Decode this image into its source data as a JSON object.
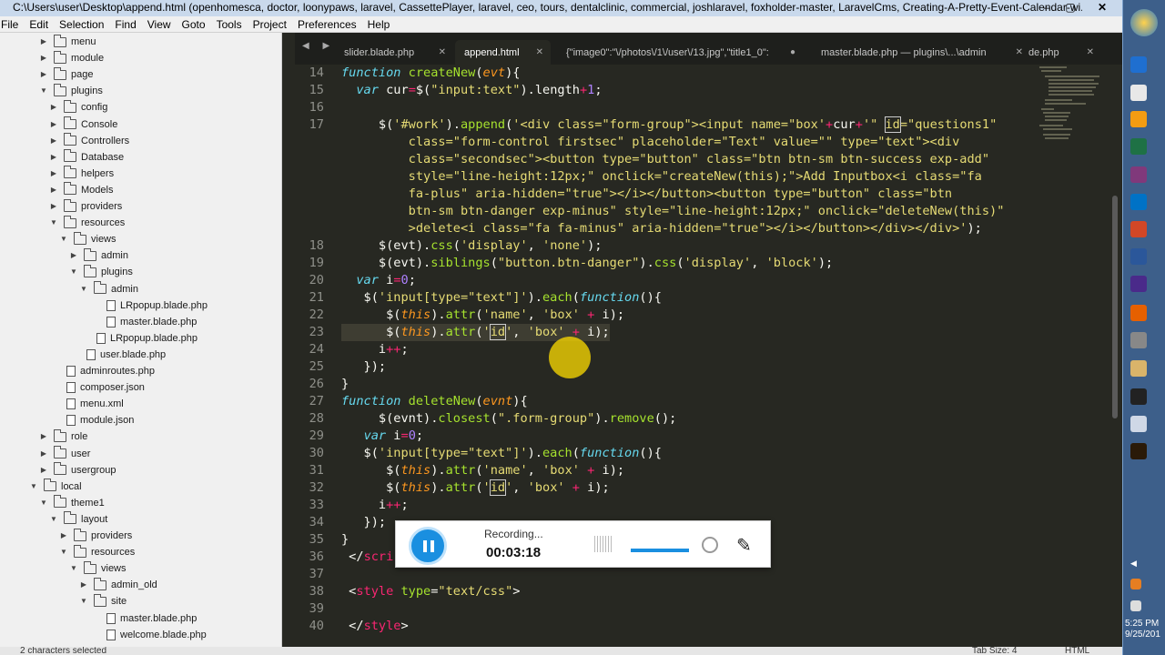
{
  "window": {
    "title": "C:\\Users\\user\\Desktop\\append.html (openhomesca, doctor, loonypaws, laravel, CassettePlayer, laravel, ceo, tours, dentalclinic, commercial, joshlaravel, foxholder-master, LaravelCms, Creating-A-Pretty-Event-Calendar-wi...",
    "controls": [
      "–",
      "▢",
      "✕"
    ]
  },
  "menu": [
    "File",
    "Edit",
    "Selection",
    "Find",
    "View",
    "Goto",
    "Tools",
    "Project",
    "Preferences",
    "Help"
  ],
  "tree": [
    {
      "label": "menu",
      "type": "folder",
      "depth": 1,
      "open": false
    },
    {
      "label": "module",
      "type": "folder",
      "depth": 1,
      "open": false
    },
    {
      "label": "page",
      "type": "folder",
      "depth": 1,
      "open": false
    },
    {
      "label": "plugins",
      "type": "folder",
      "depth": 1,
      "open": true
    },
    {
      "label": "config",
      "type": "folder",
      "depth": 2,
      "open": false
    },
    {
      "label": "Console",
      "type": "folder",
      "depth": 2,
      "open": false
    },
    {
      "label": "Controllers",
      "type": "folder",
      "depth": 2,
      "open": false
    },
    {
      "label": "Database",
      "type": "folder",
      "depth": 2,
      "open": false
    },
    {
      "label": "helpers",
      "type": "folder",
      "depth": 2,
      "open": false
    },
    {
      "label": "Models",
      "type": "folder",
      "depth": 2,
      "open": false
    },
    {
      "label": "providers",
      "type": "folder",
      "depth": 2,
      "open": false
    },
    {
      "label": "resources",
      "type": "folder",
      "depth": 2,
      "open": true
    },
    {
      "label": "views",
      "type": "folder",
      "depth": 3,
      "open": true
    },
    {
      "label": "admin",
      "type": "folder",
      "depth": 4,
      "open": false
    },
    {
      "label": "plugins",
      "type": "folder",
      "depth": 4,
      "open": true
    },
    {
      "label": "admin",
      "type": "folder",
      "depth": 5,
      "open": true
    },
    {
      "label": "LRpopup.blade.php",
      "type": "file",
      "depth": 6
    },
    {
      "label": "master.blade.php",
      "type": "file",
      "depth": 6
    },
    {
      "label": "LRpopup.blade.php",
      "type": "file",
      "depth": 5
    },
    {
      "label": "user.blade.php",
      "type": "file",
      "depth": 4
    },
    {
      "label": "adminroutes.php",
      "type": "file",
      "depth": 2
    },
    {
      "label": "composer.json",
      "type": "file",
      "depth": 2
    },
    {
      "label": "menu.xml",
      "type": "file",
      "depth": 2
    },
    {
      "label": "module.json",
      "type": "file",
      "depth": 2
    },
    {
      "label": "role",
      "type": "folder",
      "depth": 1,
      "open": false
    },
    {
      "label": "user",
      "type": "folder",
      "depth": 1,
      "open": false
    },
    {
      "label": "usergroup",
      "type": "folder",
      "depth": 1,
      "open": false
    },
    {
      "label": "local",
      "type": "folder",
      "depth": 0,
      "open": true
    },
    {
      "label": "theme1",
      "type": "folder",
      "depth": 1,
      "open": true
    },
    {
      "label": "layout",
      "type": "folder",
      "depth": 2,
      "open": true
    },
    {
      "label": "providers",
      "type": "folder",
      "depth": 3,
      "open": false
    },
    {
      "label": "resources",
      "type": "folder",
      "depth": 3,
      "open": true
    },
    {
      "label": "views",
      "type": "folder",
      "depth": 4,
      "open": true
    },
    {
      "label": "admin_old",
      "type": "folder",
      "depth": 5,
      "open": false
    },
    {
      "label": "site",
      "type": "folder",
      "depth": 5,
      "open": true
    },
    {
      "label": "master.blade.php",
      "type": "file",
      "depth": 6
    },
    {
      "label": "welcome.blade.php",
      "type": "file",
      "depth": 6
    }
  ],
  "tabs": [
    {
      "label": "slider.blade.php",
      "close": "✕",
      "active": false
    },
    {
      "label": "append.html",
      "close": "✕",
      "active": true
    },
    {
      "label": "{\"image0\":\"\\/photos\\/1\\/user\\/13.jpg\",\"title1_0\":",
      "close": "●",
      "active": false
    },
    {
      "label": "master.blade.php — plugins\\...\\admin",
      "close": "✕",
      "active": false
    },
    {
      "label": "de.php",
      "close": "✕",
      "active": false
    }
  ],
  "tab_nav": "◀ ▶",
  "tab_menu": "▼",
  "code_lines": [
    {
      "n": "14",
      "html": "<span class=\"kw\">function</span> <span class=\"fn\">createNew</span>(<span class=\"var\">evt</span>){"
    },
    {
      "n": "15",
      "html": "  <span class=\"kw\">var</span> cur<span class=\"op\">=</span>$(<span class=\"str\">\"input:text\"</span>).length<span class=\"op\">+</span><span class=\"num\">1</span>;"
    },
    {
      "n": "16",
      "html": ""
    },
    {
      "n": "17",
      "html": "     $(<span class=\"str\">'#work'</span>).<span class=\"fn\">append</span>(<span class=\"str\">'&lt;div class=\"form-group\"&gt;&lt;input name=\"box'</span><span class=\"op\">+</span>cur<span class=\"op\">+</span><span class=\"str\">'\" <span class=\"box\">id</span>=\"questions1\"</span>"
    },
    {
      "n": "",
      "html": "         <span class=\"str\">class=\"form-control firstsec\" placeholder=\"Text\" value=\"\" type=\"text\"&gt;&lt;div</span>"
    },
    {
      "n": "",
      "html": "         <span class=\"str\">class=\"secondsec\"&gt;&lt;button type=\"button\" class=\"btn btn-sm btn-success exp-add\"</span>"
    },
    {
      "n": "",
      "html": "         <span class=\"str\">style=\"line-height:12px;\" onclick=\"createNew(this);\"&gt;Add Inputbox&lt;i class=\"fa</span>"
    },
    {
      "n": "",
      "html": "         <span class=\"str\">fa-plus\" aria-hidden=\"true\"&gt;&lt;/i&gt;&lt;/button&gt;&lt;button type=\"button\" class=\"btn</span>"
    },
    {
      "n": "",
      "html": "         <span class=\"str\">btn-sm btn-danger exp-minus\" style=\"line-height:12px;\" onclick=\"deleteNew(this)\"</span>"
    },
    {
      "n": "",
      "html": "         <span class=\"str\">&gt;delete&lt;i class=\"fa fa-minus\" aria-hidden=\"true\"&gt;&lt;/i&gt;&lt;/button&gt;&lt;/div&gt;&lt;/div&gt;'</span>);"
    },
    {
      "n": "18",
      "html": "     $(evt).<span class=\"fn\">css</span>(<span class=\"str\">'display'</span>, <span class=\"str\">'none'</span>);"
    },
    {
      "n": "19",
      "html": "     $(evt).<span class=\"fn\">siblings</span>(<span class=\"str\">\"button.btn-danger\"</span>).<span class=\"fn\">css</span>(<span class=\"str\">'display'</span>, <span class=\"str\">'block'</span>);"
    },
    {
      "n": "20",
      "html": "  <span class=\"kw\">var</span> i<span class=\"op\">=</span><span class=\"num\">0</span>;"
    },
    {
      "n": "21",
      "html": "   $(<span class=\"str\">'input[type=\"text\"]'</span>).<span class=\"fn\">each</span>(<span class=\"kw\">function</span>(){"
    },
    {
      "n": "22",
      "html": "      $(<span class=\"var\">this</span>).<span class=\"fn\">attr</span>(<span class=\"str\">'name'</span>, <span class=\"str\">'box'</span> <span class=\"op\">+</span> i);"
    },
    {
      "n": "23",
      "html": "      $(<span class=\"var\">this</span>).<span class=\"fn\">attr</span>(<span class=\"str\">'<span class=\"box\">id</span>'</span>, <span class=\"str\">'box'</span> <span class=\"op\">+</span> i);",
      "hl": true
    },
    {
      "n": "24",
      "html": "     i<span class=\"op\">++</span>;"
    },
    {
      "n": "25",
      "html": "   });"
    },
    {
      "n": "26",
      "html": "}"
    },
    {
      "n": "27",
      "html": "<span class=\"kw\">function</span> <span class=\"fn\">deleteNew</span>(<span class=\"var\">evnt</span>){"
    },
    {
      "n": "28",
      "html": "     $(evnt).<span class=\"fn\">closest</span>(<span class=\"str\">\".form-group\"</span>).<span class=\"fn\">remove</span>();"
    },
    {
      "n": "29",
      "html": "   <span class=\"kw\">var</span> i<span class=\"op\">=</span><span class=\"num\">0</span>;"
    },
    {
      "n": "30",
      "html": "   $(<span class=\"str\">'input[type=\"text\"]'</span>).<span class=\"fn\">each</span>(<span class=\"kw\">function</span>(){"
    },
    {
      "n": "31",
      "html": "      $(<span class=\"var\">this</span>).<span class=\"fn\">attr</span>(<span class=\"str\">'name'</span>, <span class=\"str\">'box'</span> <span class=\"op\">+</span> i);"
    },
    {
      "n": "32",
      "html": "      $(<span class=\"var\">this</span>).<span class=\"fn\">attr</span>(<span class=\"str\">'<span class=\"box\">id</span>'</span>, <span class=\"str\">'box'</span> <span class=\"op\">+</span> i);"
    },
    {
      "n": "33",
      "html": "     i<span class=\"op\">++</span>;"
    },
    {
      "n": "34",
      "html": "   });"
    },
    {
      "n": "35",
      "html": "}"
    },
    {
      "n": "36",
      "html": " &lt;/<span class=\"tag\">scri</span>"
    },
    {
      "n": "37",
      "html": ""
    },
    {
      "n": "38",
      "html": " &lt;<span class=\"tag\">style</span> <span class=\"fn\">type</span>=<span class=\"str\">\"text/css\"</span>&gt;"
    },
    {
      "n": "39",
      "html": ""
    },
    {
      "n": "40",
      "html": " &lt;/<span class=\"tag\">style</span>&gt;"
    }
  ],
  "recorder": {
    "status": "Recording...",
    "time": "00:03:18"
  },
  "status": {
    "left": "2 characters selected",
    "tab_size": "Tab Size: 4",
    "syntax": "HTML"
  },
  "clock": {
    "time": "5:25 PM",
    "date": "9/25/201"
  },
  "colors": {
    "editor_bg": "#272822",
    "keyword": "#66d9ef",
    "function": "#a6e22e",
    "string": "#e6db74",
    "operator": "#f92672",
    "number": "#ae81ff",
    "recorder_accent": "#1a8fe0"
  }
}
